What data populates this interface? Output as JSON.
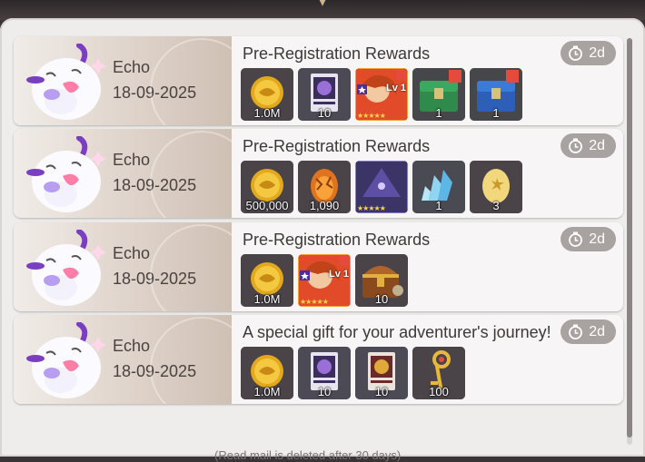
{
  "footer_note": "(Read mail is deleted after 30 days)",
  "mails": [
    {
      "sender": "Echo",
      "date": "18-09-2025",
      "title": "Pre-Registration Rewards",
      "expires": "2d",
      "items": [
        {
          "icon": "gold-coin-icon",
          "qty": "1.0M"
        },
        {
          "icon": "purple-card-icon",
          "qty": "10"
        },
        {
          "icon": "hero-portrait-icon",
          "qty": "",
          "level": "Lv 1",
          "stars": "★★★★★"
        },
        {
          "icon": "green-chest-icon",
          "qty": "1"
        },
        {
          "icon": "blue-chest-icon",
          "qty": "1"
        }
      ]
    },
    {
      "sender": "Echo",
      "date": "18-09-2025",
      "title": "Pre-Registration Rewards",
      "expires": "2d",
      "items": [
        {
          "icon": "gold-coin-icon",
          "qty": "500,000"
        },
        {
          "icon": "orange-egg-icon",
          "qty": "1,090"
        },
        {
          "icon": "dark-card-icon",
          "qty": "",
          "stars": "★★★★★"
        },
        {
          "icon": "crystal-icon",
          "qty": "1"
        },
        {
          "icon": "golden-egg-icon",
          "qty": "3"
        }
      ]
    },
    {
      "sender": "Echo",
      "date": "18-09-2025",
      "title": "Pre-Registration Rewards",
      "expires": "2d",
      "items": [
        {
          "icon": "gold-coin-icon",
          "qty": "1.0M"
        },
        {
          "icon": "hero-portrait-icon",
          "qty": "",
          "level": "Lv 1",
          "stars": "★★★★★"
        },
        {
          "icon": "treasure-chest-icon",
          "qty": "10"
        }
      ]
    },
    {
      "sender": "Echo",
      "date": "18-09-2025",
      "title": "A special gift for your adventurer's journey!",
      "expires": "2d",
      "items": [
        {
          "icon": "gold-coin-icon",
          "qty": "1.0M"
        },
        {
          "icon": "purple-card-icon",
          "qty": "10"
        },
        {
          "icon": "red-card-icon",
          "qty": "10"
        },
        {
          "icon": "golden-key-icon",
          "qty": "100"
        }
      ]
    }
  ]
}
